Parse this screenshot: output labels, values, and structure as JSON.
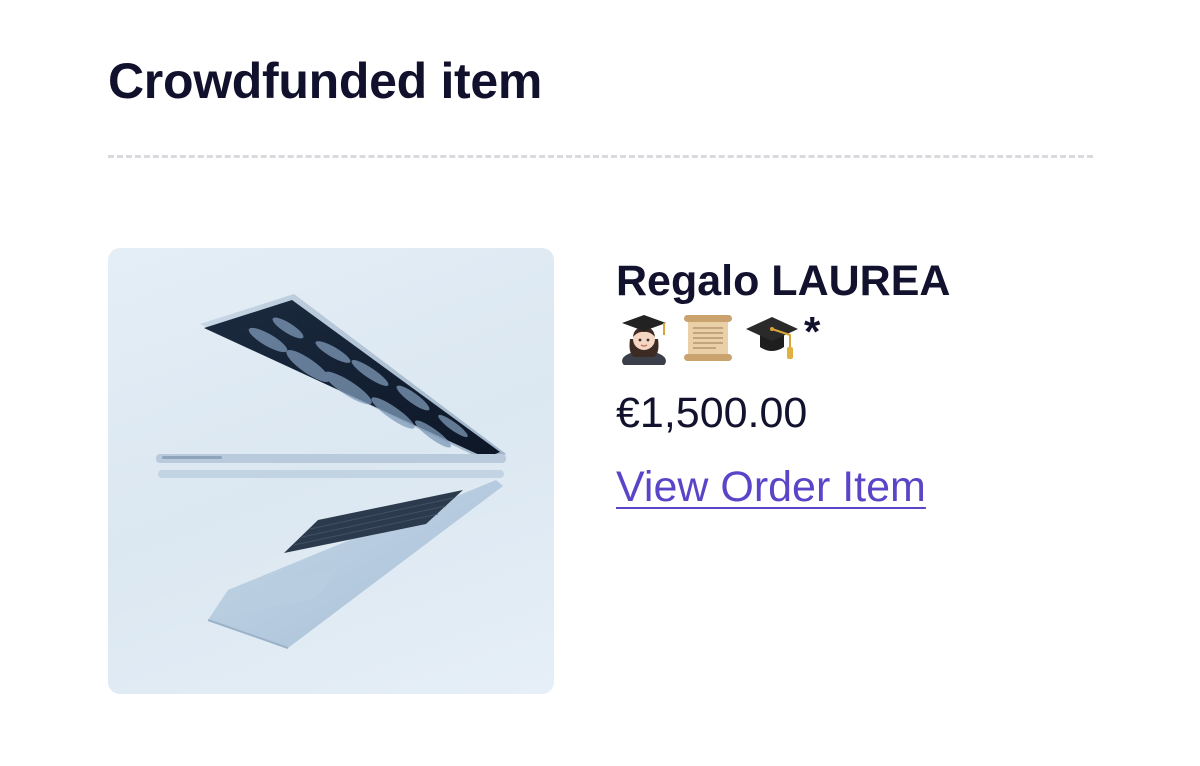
{
  "section": {
    "title": "Crowdfunded item"
  },
  "item": {
    "title": "Regalo LAUREA",
    "emojis": [
      "woman-student-emoji",
      "scroll-emoji",
      "graduation-cap-emoji"
    ],
    "emoji_suffix": "*",
    "price": "€1,500.00",
    "link_label": "View Order Item",
    "image": "laptop-image"
  },
  "colors": {
    "text": "#12122e",
    "link": "#5a45c8",
    "divider": "#d9d9de",
    "image_background": "#dfe9f3"
  }
}
